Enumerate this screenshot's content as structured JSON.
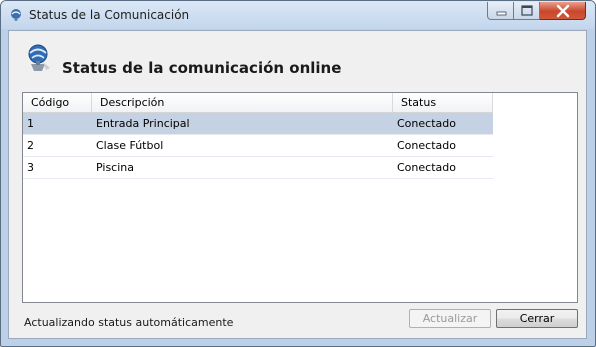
{
  "window": {
    "title": "Status de la Comunicación"
  },
  "header": {
    "title": "Status de la comunicación online",
    "icon": "network-globe-icon"
  },
  "table": {
    "columns": [
      "Código",
      "Descripción",
      "Status"
    ],
    "rows": [
      {
        "codigo": "1",
        "descripcion": "Entrada Principal",
        "status": "Conectado",
        "selected": true
      },
      {
        "codigo": "2",
        "descripcion": "Clase Fútbol",
        "status": "Conectado",
        "selected": false
      },
      {
        "codigo": "3",
        "descripcion": "Piscina",
        "status": "Conectado",
        "selected": false
      }
    ]
  },
  "footer": {
    "status_text": "Actualizando status automáticamente",
    "actualizar_label": "Actualizar",
    "cerrar_label": "Cerrar"
  },
  "colors": {
    "selected_row": "#c4d2e3",
    "window_frame": "#bcd0e7",
    "close_button": "#c9462c"
  }
}
